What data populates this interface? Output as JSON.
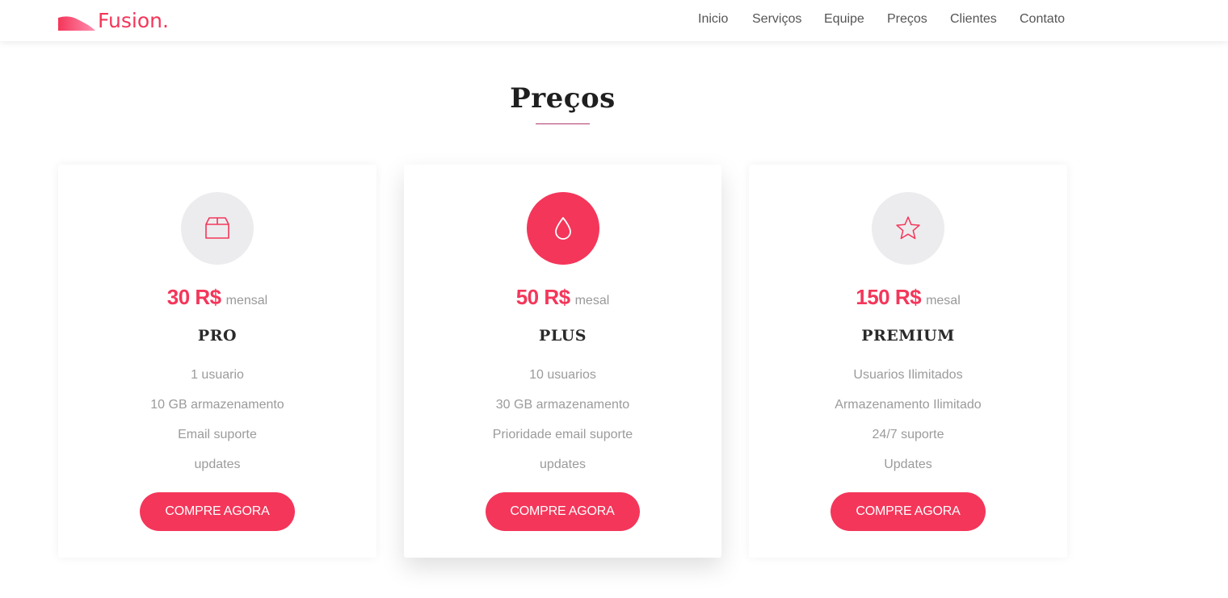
{
  "brand": {
    "name": "Fusion.",
    "accent_color": "#f4365a",
    "icon": "wave-logo-icon"
  },
  "nav": {
    "items": [
      {
        "label": "Inicio",
        "active": false
      },
      {
        "label": "Serviços",
        "active": false
      },
      {
        "label": "Equipe",
        "active": false
      },
      {
        "label": "Preços",
        "active": true
      },
      {
        "label": "Clientes",
        "active": false
      },
      {
        "label": "Contato",
        "active": false
      }
    ]
  },
  "section": {
    "title": "Preços"
  },
  "plans": [
    {
      "icon": "box-icon",
      "price": "30 R$",
      "period": "mensal",
      "name": "PRO",
      "featured": false,
      "features": [
        "1 usuario",
        "10 GB armazenamento",
        "Email suporte",
        "updates"
      ],
      "button_label": "COMPRE AGORA"
    },
    {
      "icon": "droplet-icon",
      "price": "50 R$",
      "period": "mesal",
      "name": "PLUS",
      "featured": true,
      "features": [
        "10 usuarios",
        "30 GB armazenamento",
        "Prioridade email suporte",
        "updates"
      ],
      "button_label": "COMPRE AGORA"
    },
    {
      "icon": "star-icon",
      "price": "150 R$",
      "period": "mesal",
      "name": "PREMIUM",
      "featured": false,
      "features": [
        "Usuarios Ilimitados",
        "Armazenamento Ilimitado",
        "24/7 suporte",
        "Updates"
      ],
      "button_label": "COMPRE AGORA"
    }
  ]
}
